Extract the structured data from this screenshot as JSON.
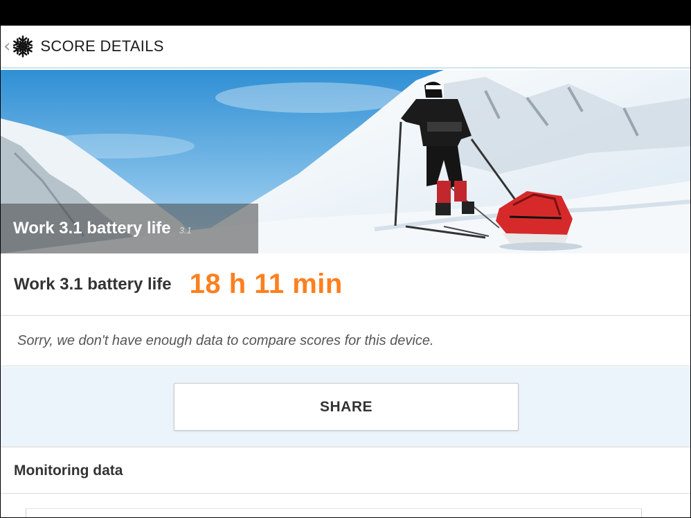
{
  "app_bar": {
    "title": "SCORE DETAILS",
    "back_icon": "chevron-left-icon",
    "logo_icon": "snowflake-icon"
  },
  "hero": {
    "title": "Work 3.1 battery life",
    "version": "3.1"
  },
  "score": {
    "label": "Work 3.1 battery life",
    "value": "18 h 11 min",
    "value_color": "#ff7f1e"
  },
  "compare": {
    "message": "Sorry, we don't have enough data to compare scores for this device."
  },
  "share": {
    "label": "SHARE"
  },
  "monitoring": {
    "label": "Monitoring data"
  }
}
